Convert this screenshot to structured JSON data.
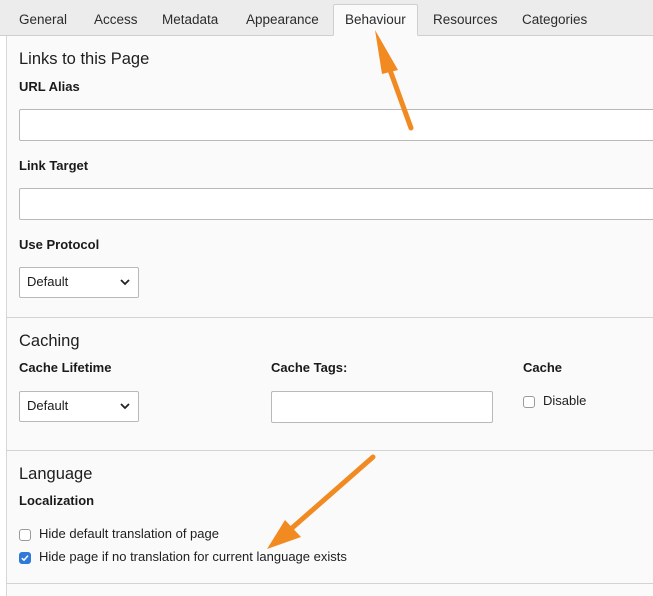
{
  "tabs": [
    {
      "label": "General"
    },
    {
      "label": "Access"
    },
    {
      "label": "Metadata"
    },
    {
      "label": "Appearance"
    },
    {
      "label": "Behaviour"
    },
    {
      "label": "Resources"
    },
    {
      "label": "Categories"
    }
  ],
  "active_tab": "Behaviour",
  "links": {
    "title": "Links to this Page",
    "url_alias_label": "URL Alias",
    "url_alias_value": "",
    "link_target_label": "Link Target",
    "link_target_value": "",
    "use_protocol_label": "Use Protocol",
    "use_protocol_value": "Default"
  },
  "caching": {
    "title": "Caching",
    "cache_lifetime_label": "Cache Lifetime",
    "cache_lifetime_value": "Default",
    "cache_tags_label": "Cache Tags:",
    "cache_tags_value": "",
    "cache_label": "Cache",
    "disable_label": "Disable",
    "disable_checked": false
  },
  "language": {
    "title": "Language",
    "localization_label": "Localization",
    "hide_default_label": "Hide default translation of page",
    "hide_default_checked": false,
    "hide_no_translation_label": "Hide page if no translation for current language exists",
    "hide_no_translation_checked": true
  },
  "colors": {
    "accent": "#2f7ad9",
    "annotation_arrow": "#f28a22"
  },
  "icons": {
    "select_arrow": "chevron-down-icon",
    "checkmark": "checkmark-icon",
    "annotation": "arrow-annotation"
  }
}
